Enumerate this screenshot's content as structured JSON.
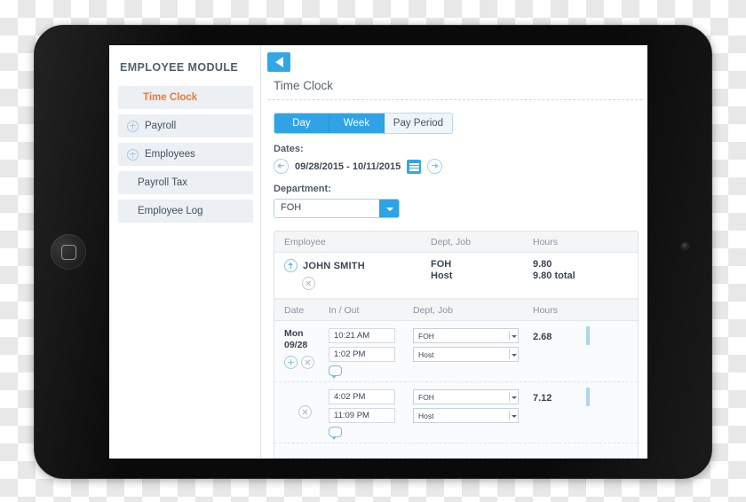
{
  "sidebar": {
    "title": "EMPLOYEE MODULE",
    "items": [
      {
        "label": "Time Clock",
        "active": true,
        "icon": "none"
      },
      {
        "label": "Payroll",
        "active": false,
        "icon": "plus-icon"
      },
      {
        "label": "Employees",
        "active": false,
        "icon": "plus-icon"
      },
      {
        "label": "Payroll Tax",
        "active": false,
        "icon": "none"
      },
      {
        "label": "Employee Log",
        "active": false,
        "icon": "none"
      }
    ]
  },
  "main": {
    "back_icon": "back-triangle-icon",
    "page_title": "Time Clock",
    "segments": [
      {
        "label": "Day",
        "selected": true
      },
      {
        "label": "Week",
        "selected": true
      },
      {
        "label": "Pay Period",
        "selected": false
      }
    ],
    "dates_label": "Dates:",
    "date_range": "09/28/2015 - 10/11/2015",
    "prev_icon": "arrow-left-circle-icon",
    "next_icon": "arrow-right-circle-icon",
    "calendar_icon": "calendar-icon",
    "department_label": "Department:",
    "department_value": "FOH"
  },
  "table": {
    "headers": {
      "employee": "Employee",
      "dept_job": "Dept, Job",
      "hours": "Hours"
    },
    "employee": {
      "name": "JOHN SMITH",
      "dept": "FOH",
      "job": "Host",
      "hours": "9.80",
      "hours_total": "9.80 total",
      "expand_icon": "arrow-up-circle-icon",
      "delete_icon": "x-circle-icon"
    },
    "detail_headers": {
      "date": "Date",
      "in_out": "In / Out",
      "dept_job": "Dept, Job",
      "hours": "Hours"
    },
    "rows": [
      {
        "day": "Mon",
        "date": "09/28",
        "time_in": "10:21 AM",
        "time_out": "1:02 PM",
        "dept": "FOH",
        "job": "Host",
        "hours": "2.68",
        "add_icon": "plus-circle-icon",
        "delete_icon": "x-circle-icon",
        "note_icon": "comment-icon",
        "show_date": true,
        "show_add": true
      },
      {
        "day": "",
        "date": "",
        "time_in": "4:02 PM",
        "time_out": "11:09 PM",
        "dept": "FOH",
        "job": "Host",
        "hours": "7.12",
        "add_icon": "plus-circle-icon",
        "delete_icon": "x-circle-icon",
        "note_icon": "comment-icon",
        "show_date": false,
        "show_add": false
      }
    ]
  },
  "colors": {
    "accent_blue": "#32a7e8",
    "active_orange": "#f2762e",
    "header_gray": "#f3f5f7"
  }
}
